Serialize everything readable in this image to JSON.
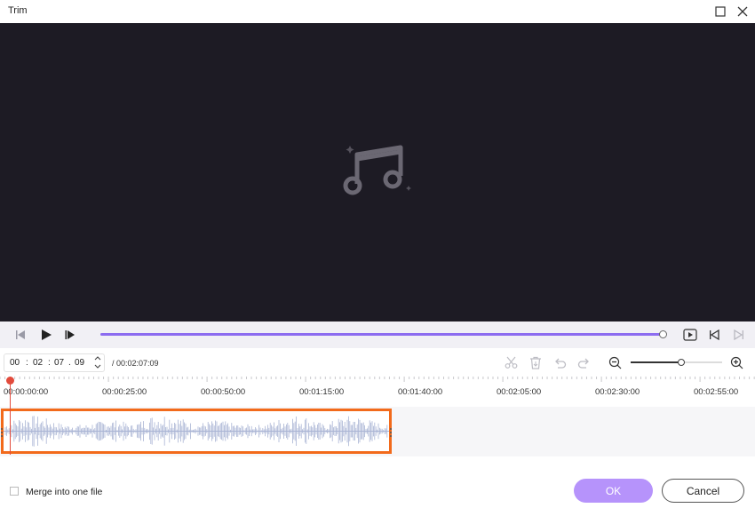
{
  "window": {
    "title": "Trim",
    "maximize_icon": "maximize-icon",
    "close_icon": "close-icon"
  },
  "preview": {
    "placeholder_icon": "music-note-icon",
    "background": "#1d1b24"
  },
  "playback": {
    "prev_frame_icon": "step-back-icon",
    "play_icon": "play-icon",
    "next_frame_icon": "step-forward-icon",
    "progress": 1.0,
    "preview_clip_icon": "play-in-frame-icon",
    "jump_start_icon": "jump-to-start-icon",
    "jump_end_icon": "jump-to-end-icon",
    "accent": "#8c6cf0"
  },
  "time": {
    "hh": "00",
    "mm": "02",
    "ss": "07",
    "ff": "09",
    "sep1": ":",
    "sep2": ":",
    "sep3": ".",
    "spin_up": "^",
    "spin_down": "v",
    "duration": "/ 00:02:07:09"
  },
  "tools": {
    "cut_icon": "scissors-icon",
    "delete_icon": "trash-icon",
    "undo_icon": "undo-icon",
    "redo_icon": "redo-icon",
    "zoom_out_icon": "zoom-out-icon",
    "zoom_in_icon": "zoom-in-icon",
    "zoom_level": 0.55
  },
  "ruler": {
    "labels": [
      "00:00:00:00",
      "00:00:25:00",
      "00:00:50:00",
      "00:01:15:00",
      "00:01:40:00",
      "00:02:05:00",
      "00:02:30:00",
      "00:02:55:00"
    ]
  },
  "clip": {
    "border_color": "#f26a1b",
    "waveform_color": "#a9b4d4"
  },
  "footer": {
    "merge_label": "Merge into one file",
    "merge_checked": false,
    "ok_label": "OK",
    "cancel_label": "Cancel",
    "ok_color": "#b693fb"
  }
}
